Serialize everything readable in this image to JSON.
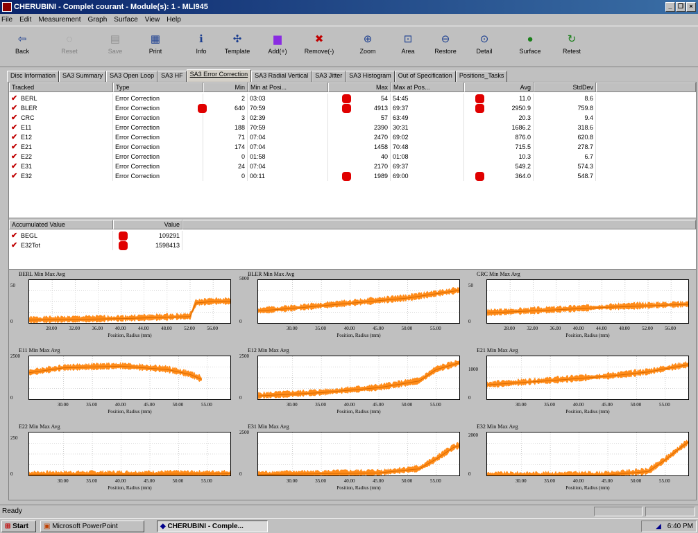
{
  "window": {
    "title": "CHERUBINI - Complet courant - Module(s): 1 - MLI945"
  },
  "menu": [
    "File",
    "Edit",
    "Measurement",
    "Graph",
    "Surface",
    "View",
    "Help"
  ],
  "toolbar": [
    {
      "label": "Back",
      "icon": "back-arrow-icon",
      "glyph": "⇦",
      "disabled": false
    },
    {
      "label": "Reset",
      "icon": "reset-icon",
      "glyph": "◌",
      "disabled": true
    },
    {
      "label": "Save",
      "icon": "save-icon",
      "glyph": "▤",
      "disabled": true
    },
    {
      "label": "Print",
      "icon": "printer-icon",
      "glyph": "▦",
      "disabled": false
    },
    {
      "label": "Info",
      "icon": "info-icon",
      "glyph": "ℹ",
      "disabled": false
    },
    {
      "label": "Template",
      "icon": "template-icon",
      "glyph": "✣",
      "disabled": false
    },
    {
      "label": "Add(+)",
      "icon": "add-chart-icon",
      "glyph": "▆",
      "disabled": false
    },
    {
      "label": "Remove(-)",
      "icon": "remove-chart-icon",
      "glyph": "✖",
      "disabled": false
    },
    {
      "label": "Zoom",
      "icon": "zoom-icon",
      "glyph": "⊕",
      "disabled": false
    },
    {
      "label": "Area",
      "icon": "area-zoom-icon",
      "glyph": "⊡",
      "disabled": false
    },
    {
      "label": "Restore",
      "icon": "restore-icon",
      "glyph": "⊖",
      "disabled": false
    },
    {
      "label": "Detail",
      "icon": "detail-icon",
      "glyph": "⊙",
      "disabled": false
    },
    {
      "label": "Surface",
      "icon": "surface-icon",
      "glyph": "●",
      "disabled": false
    },
    {
      "label": "Retest",
      "icon": "retest-icon",
      "glyph": "↻",
      "disabled": false
    }
  ],
  "tabs": [
    "Disc Information",
    "SA3 Summary",
    "SA3 Open Loop",
    "SA3 HF",
    "SA3 Error Correction",
    "SA3 Radial Vertical",
    "SA3 Jitter",
    "SA3 Histogram",
    "Out of Specification",
    "Positions_Tasks"
  ],
  "active_tab": 4,
  "table": {
    "headers": [
      "Tracked",
      "Type",
      "Min",
      "Min at Posi...",
      "Max",
      "Max at Pos...",
      "Avg",
      "StdDev"
    ],
    "rows": [
      {
        "name": "BERL",
        "type": "Error Correction",
        "min": "2",
        "min_at": "03:03",
        "max": "54",
        "max_at": "54:45",
        "avg": "11.0",
        "std": "8.6",
        "flag_min": false,
        "flag_max": true,
        "flag_avg": true
      },
      {
        "name": "BLER",
        "type": "Error Correction",
        "min": "640",
        "min_at": "70:59",
        "max": "4913",
        "max_at": "69:37",
        "avg": "2950.9",
        "std": "759.8",
        "flag_min": true,
        "flag_max": true,
        "flag_avg": true
      },
      {
        "name": "CRC",
        "type": "Error Correction",
        "min": "3",
        "min_at": "02:39",
        "max": "57",
        "max_at": "63:49",
        "avg": "20.3",
        "std": "9.4",
        "flag_min": false,
        "flag_max": false,
        "flag_avg": false
      },
      {
        "name": "E11",
        "type": "Error Correction",
        "min": "188",
        "min_at": "70:59",
        "max": "2390",
        "max_at": "30:31",
        "avg": "1686.2",
        "std": "318.6",
        "flag_min": false,
        "flag_max": false,
        "flag_avg": false
      },
      {
        "name": "E12",
        "type": "Error Correction",
        "min": "71",
        "min_at": "07:04",
        "max": "2470",
        "max_at": "69:02",
        "avg": "876.0",
        "std": "620.8",
        "flag_min": false,
        "flag_max": false,
        "flag_avg": false
      },
      {
        "name": "E21",
        "type": "Error Correction",
        "min": "174",
        "min_at": "07:04",
        "max": "1458",
        "max_at": "70:48",
        "avg": "715.5",
        "std": "278.7",
        "flag_min": false,
        "flag_max": false,
        "flag_avg": false
      },
      {
        "name": "E22",
        "type": "Error Correction",
        "min": "0",
        "min_at": "01:58",
        "max": "40",
        "max_at": "01:08",
        "avg": "10.3",
        "std": "6.7",
        "flag_min": false,
        "flag_max": false,
        "flag_avg": false
      },
      {
        "name": "E31",
        "type": "Error Correction",
        "min": "24",
        "min_at": "07:04",
        "max": "2170",
        "max_at": "69:37",
        "avg": "549.2",
        "std": "574.3",
        "flag_min": false,
        "flag_max": false,
        "flag_avg": false
      },
      {
        "name": "E32",
        "type": "Error Correction",
        "min": "0",
        "min_at": "00:11",
        "max": "1989",
        "max_at": "69:00",
        "avg": "364.0",
        "std": "548.7",
        "flag_min": false,
        "flag_max": true,
        "flag_avg": true
      }
    ]
  },
  "accum": {
    "headers": [
      "Accumulated Value",
      "Value"
    ],
    "rows": [
      {
        "name": "BEGL",
        "value": "109291",
        "flag": true
      },
      {
        "name": "E32Tot",
        "value": "1598413",
        "flag": true
      }
    ]
  },
  "chart_color": "#ff8c1a",
  "flag_color": "#e00000",
  "chart_data": [
    {
      "type": "area",
      "title": "BERL Min Max Avg",
      "xlabel": "Position, Radius (mm)",
      "yticks": [
        "50",
        "0"
      ],
      "ylim": [
        0,
        60
      ],
      "xticks": [
        "28.00",
        "32.00",
        "36.00",
        "40.00",
        "44.00",
        "48.00",
        "52.00",
        "56.00"
      ],
      "xlim": [
        24,
        59
      ],
      "points": [
        [
          24,
          4
        ],
        [
          40,
          6
        ],
        [
          52,
          9
        ],
        [
          53,
          28
        ],
        [
          56,
          30
        ],
        [
          59,
          30
        ]
      ]
    },
    {
      "type": "area",
      "title": "BLER Min Max Avg",
      "xlabel": "Position, Radius (mm)",
      "yticks": [
        "5000",
        "0"
      ],
      "ylim": [
        0,
        5000
      ],
      "xticks": [
        "30.00",
        "35.00",
        "40.00",
        "45.00",
        "50.00",
        "55.00"
      ],
      "xlim": [
        24,
        59
      ],
      "points": [
        [
          24,
          1400
        ],
        [
          30,
          1700
        ],
        [
          40,
          2300
        ],
        [
          50,
          2900
        ],
        [
          55,
          3400
        ],
        [
          59,
          3800
        ]
      ]
    },
    {
      "type": "area",
      "title": "CRC Min Max Avg",
      "xlabel": "Position, Radius (mm)",
      "yticks": [
        "50",
        "0"
      ],
      "ylim": [
        0,
        60
      ],
      "xticks": [
        "28.00",
        "32.00",
        "36.00",
        "40.00",
        "44.00",
        "48.00",
        "52.00",
        "56.00"
      ],
      "xlim": [
        24,
        59
      ],
      "points": [
        [
          24,
          14
        ],
        [
          35,
          18
        ],
        [
          45,
          22
        ],
        [
          55,
          25
        ],
        [
          59,
          26
        ]
      ]
    },
    {
      "type": "area",
      "title": "E11 Min Max Avg",
      "xlabel": "Position, Radius (mm)",
      "yticks": [
        "2500",
        "0"
      ],
      "ylim": [
        0,
        2600
      ],
      "xticks": [
        "30.00",
        "35.00",
        "40.00",
        "45.00",
        "50.00",
        "55.00"
      ],
      "xlim": [
        24,
        59
      ],
      "points": [
        [
          24,
          1600
        ],
        [
          30,
          1900
        ],
        [
          40,
          2000
        ],
        [
          48,
          1800
        ],
        [
          52,
          1500
        ],
        [
          54,
          1200
        ]
      ]
    },
    {
      "type": "area",
      "title": "E12 Min Max Avg",
      "xlabel": "Position, Radius (mm)",
      "yticks": [
        "2500",
        "0"
      ],
      "ylim": [
        0,
        2600
      ],
      "xticks": [
        "30.00",
        "35.00",
        "40.00",
        "45.00",
        "50.00",
        "55.00"
      ],
      "xlim": [
        24,
        59
      ],
      "points": [
        [
          24,
          200
        ],
        [
          35,
          400
        ],
        [
          45,
          700
        ],
        [
          52,
          1100
        ],
        [
          55,
          1800
        ],
        [
          59,
          2200
        ]
      ]
    },
    {
      "type": "area",
      "title": "E21 Min Max Avg",
      "xlabel": "Position, Radius (mm)",
      "yticks": [
        "1000",
        "0"
      ],
      "ylim": [
        0,
        1500
      ],
      "xticks": [
        "30.00",
        "35.00",
        "40.00",
        "45.00",
        "50.00",
        "55.00"
      ],
      "xlim": [
        24,
        59
      ],
      "points": [
        [
          24,
          500
        ],
        [
          35,
          650
        ],
        [
          45,
          800
        ],
        [
          52,
          950
        ],
        [
          56,
          1100
        ],
        [
          59,
          1200
        ]
      ]
    },
    {
      "type": "area",
      "title": "E22 Min Max Avg",
      "xlabel": "Position, Radius (mm)",
      "yticks": [
        "250",
        "0"
      ],
      "ylim": [
        0,
        300
      ],
      "xticks": [
        "30.00",
        "35.00",
        "40.00",
        "45.00",
        "50.00",
        "55.00"
      ],
      "xlim": [
        24,
        59
      ],
      "points": [
        [
          24,
          6
        ],
        [
          40,
          8
        ],
        [
          55,
          10
        ],
        [
          59,
          12
        ]
      ]
    },
    {
      "type": "area",
      "title": "E31 Min Max Avg",
      "xlabel": "Position, Radius (mm)",
      "yticks": [
        "2500",
        "0"
      ],
      "ylim": [
        0,
        2600
      ],
      "xticks": [
        "30.00",
        "35.00",
        "40.00",
        "45.00",
        "50.00",
        "55.00"
      ],
      "xlim": [
        24,
        59
      ],
      "points": [
        [
          24,
          50
        ],
        [
          45,
          150
        ],
        [
          52,
          400
        ],
        [
          55,
          1000
        ],
        [
          58,
          1700
        ],
        [
          59,
          1800
        ]
      ]
    },
    {
      "type": "area",
      "title": "E32 Min Max Avg",
      "xlabel": "Position, Radius (mm)",
      "yticks": [
        "2000",
        "0"
      ],
      "ylim": [
        0,
        2200
      ],
      "xticks": [
        "30.00",
        "35.00",
        "40.00",
        "45.00",
        "50.00",
        "55.00"
      ],
      "xlim": [
        24,
        59
      ],
      "points": [
        [
          24,
          0
        ],
        [
          45,
          30
        ],
        [
          52,
          200
        ],
        [
          55,
          800
        ],
        [
          58,
          1500
        ],
        [
          59,
          1700
        ]
      ]
    }
  ],
  "status": {
    "text": "Ready"
  },
  "taskbar": {
    "start": "Start",
    "items": [
      "Microsoft PowerPoint",
      "CHERUBINI - Comple..."
    ],
    "clock": "6:40 PM"
  }
}
